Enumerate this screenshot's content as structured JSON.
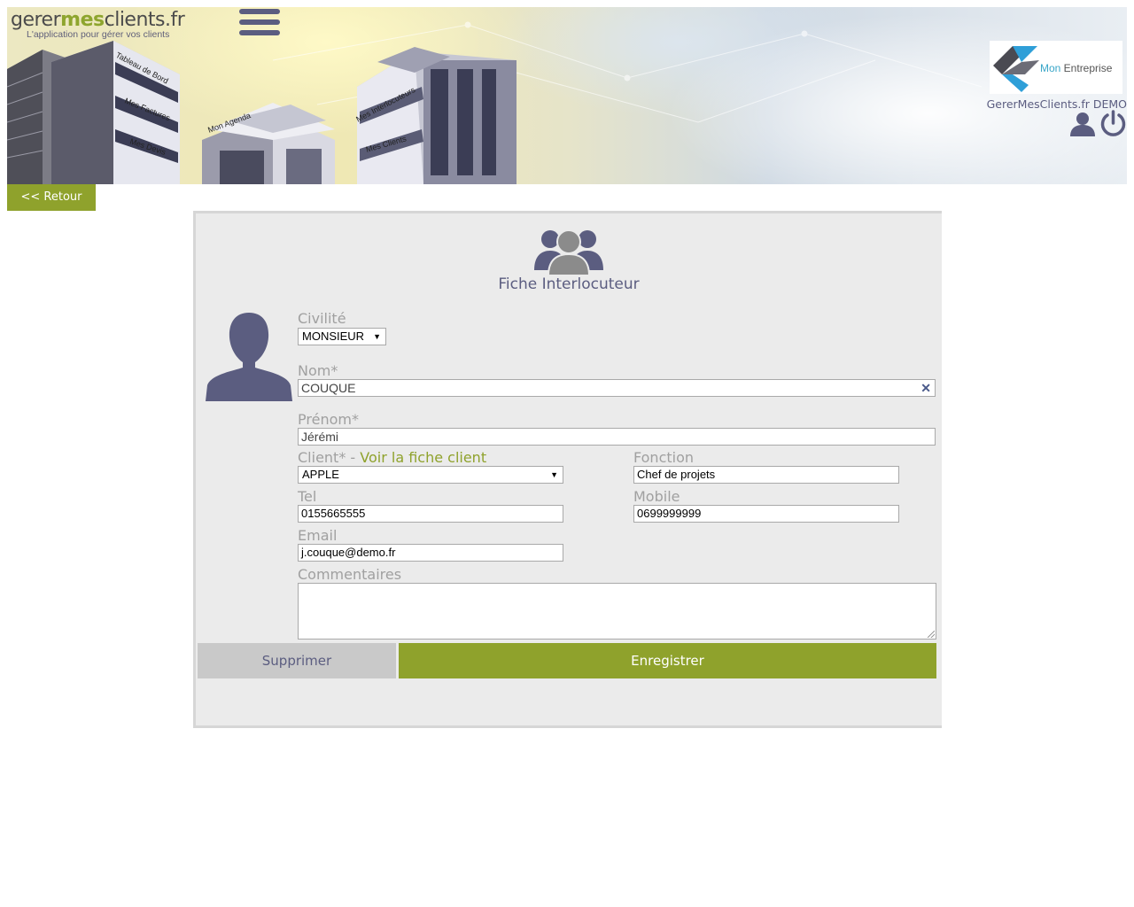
{
  "header": {
    "logo": {
      "part1": "gerer",
      "part2": "mes",
      "part3": "clients.fr",
      "tagline": "L'application pour gérer vos clients"
    },
    "buildings": {
      "tableau": "Tableau de Bord",
      "factures": "Mes Factures",
      "devis": "Mes Devis",
      "agenda": "Mon Agenda",
      "interlocuteurs": "Mes Interlocuteurs",
      "clients": "Mes Clients"
    },
    "company": {
      "mon": "Mon",
      "entreprise": " Entreprise"
    },
    "account_label": "GererMesClients.fr DEMO"
  },
  "nav": {
    "back_label": "<< Retour"
  },
  "form": {
    "title": "Fiche Interlocuteur",
    "civilite": {
      "label": "Civilité",
      "value": "MONSIEUR"
    },
    "nom": {
      "label": "Nom*",
      "value": "COUQUE"
    },
    "prenom": {
      "label": "Prénom*",
      "value": "Jérémi"
    },
    "client": {
      "label": "Client* - ",
      "link": "Voir la fiche client",
      "value": "APPLE"
    },
    "fonction": {
      "label": "Fonction",
      "value": "Chef de projets"
    },
    "tel": {
      "label": "Tel",
      "value": "0155665555"
    },
    "mobile": {
      "label": "Mobile",
      "value": "0699999999"
    },
    "email": {
      "label": "Email",
      "value": "j.couque@demo.fr"
    },
    "commentaires": {
      "label": "Commentaires",
      "value": ""
    }
  },
  "actions": {
    "delete_label": "Supprimer",
    "save_label": "Enregistrer"
  },
  "colors": {
    "accent": "#8fa22c",
    "primary": "#5b5d80",
    "label": "#a0a0a0",
    "panel": "#ebebeb"
  },
  "icons": [
    "menu-icon",
    "user-icon",
    "power-icon",
    "group-icon",
    "avatar-icon",
    "clear-icon",
    "dropdown-arrow-icon"
  ]
}
